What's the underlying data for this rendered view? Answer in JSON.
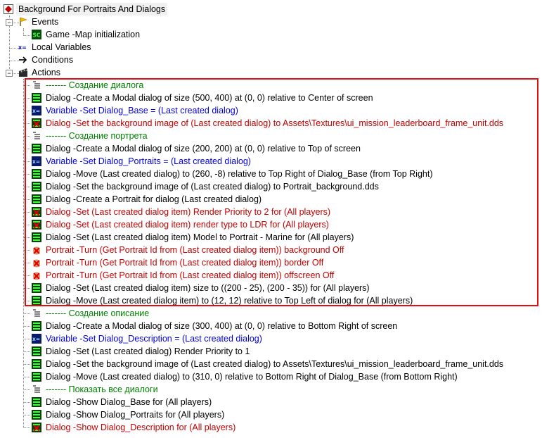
{
  "colors": {
    "black": "#000000",
    "blue": "#0000dd",
    "red": "#c00000",
    "green": "#008000",
    "selection_border": "#e01010"
  },
  "root": {
    "label": "Background For Portraits And Dialogs",
    "icon": "trigger-icon"
  },
  "events": {
    "label": "Events",
    "icon": "flag-icon"
  },
  "event_item": {
    "label": "Game -Map initialization",
    "icon": "event-sc-icon"
  },
  "local_variables": {
    "label": "Local Variables",
    "icon": "variables-icon"
  },
  "conditions": {
    "label": "Conditions",
    "icon": "arrow-icon"
  },
  "actions": {
    "label": "Actions",
    "icon": "clapper-icon"
  },
  "action_rows": [
    {
      "text": "------- Создание диалога",
      "color": "green",
      "icon": "comment-icon"
    },
    {
      "text": "Dialog -Create a Modal dialog of size (500, 400) at (0, 0) relative to Center of screen",
      "color": "black",
      "icon": "action-icon"
    },
    {
      "text": "Variable -Set Dialog_Base = (Last created dialog)",
      "color": "blue",
      "icon": "variable-set-icon"
    },
    {
      "text": "Dialog -Set the background image of (Last created dialog) to Assets\\Textures\\ui_mission_leaderboard_frame_unit.dds",
      "color": "red",
      "icon": "action-error-icon"
    },
    {
      "text": "------- Создание портрета",
      "color": "green",
      "icon": "comment-icon"
    },
    {
      "text": "Dialog -Create a Modal dialog of size (200, 200) at (0, 0) relative to Top of screen",
      "color": "black",
      "icon": "action-icon"
    },
    {
      "text": "Variable -Set Dialog_Portraits = (Last created dialog)",
      "color": "blue",
      "icon": "variable-set-icon"
    },
    {
      "text": "Dialog -Move (Last created dialog) to (260, -8) relative to Top Right of Dialog_Base (from Top Right)",
      "color": "black",
      "icon": "action-icon"
    },
    {
      "text": "Dialog -Set the background image of (Last created dialog) to Portrait_background.dds",
      "color": "black",
      "icon": "action-icon"
    },
    {
      "text": "Dialog -Create a Portrait for dialog (Last created dialog)",
      "color": "black",
      "icon": "action-icon"
    },
    {
      "text": "Dialog -Set (Last created dialog item) Render Priority to 2 for (All players)",
      "color": "red",
      "icon": "action-error-icon"
    },
    {
      "text": "Dialog -Set (Last created dialog item) render type to LDR for (All players)",
      "color": "red",
      "icon": "action-error-icon"
    },
    {
      "text": "Dialog -Set (Last created dialog item) Model  to Portrait - Marine for (All players)",
      "color": "black",
      "icon": "action-icon"
    },
    {
      "text": "Portrait -Turn (Get Portrait Id from (Last created dialog item)) background Off",
      "color": "red",
      "icon": "portrait-error-icon"
    },
    {
      "text": "Portrait -Turn (Get Portrait Id from (Last created dialog item)) border Off",
      "color": "red",
      "icon": "portrait-error-icon"
    },
    {
      "text": "Portrait -Turn (Get Portrait Id from (Last created dialog item)) offscreen Off",
      "color": "red",
      "icon": "portrait-error-icon"
    },
    {
      "text": "Dialog -Set (Last created dialog item) size to ((200 - 25), (200 - 35)) for (All players)",
      "color": "black",
      "icon": "action-icon"
    },
    {
      "text": "Dialog -Move (Last created dialog item) to (12, 12) relative to Top Left of dialog for (All players)",
      "color": "black",
      "icon": "action-icon"
    },
    {
      "text": "------- Создание описание",
      "color": "green",
      "icon": "comment-icon"
    },
    {
      "text": "Dialog -Create a Modal dialog of size (300, 400) at (0, 0) relative to Bottom Right of screen",
      "color": "black",
      "icon": "action-icon"
    },
    {
      "text": "Variable -Set Dialog_Description = (Last created dialog)",
      "color": "blue",
      "icon": "variable-set-icon"
    },
    {
      "text": "Dialog -Set (Last created dialog) Render Priority to 1",
      "color": "black",
      "icon": "action-icon"
    },
    {
      "text": "Dialog -Set the background image of (Last created dialog) to Assets\\Textures\\ui_mission_leaderboard_frame_unit.dds",
      "color": "black",
      "icon": "action-icon"
    },
    {
      "text": "Dialog -Move (Last created dialog) to (310, 0) relative to Bottom Right of Dialog_Base (from Bottom Right)",
      "color": "black",
      "icon": "action-icon"
    },
    {
      "text": "------- Показать все диалоги",
      "color": "green",
      "icon": "comment-icon"
    },
    {
      "text": "Dialog -Show Dialog_Base for (All players)",
      "color": "black",
      "icon": "action-icon"
    },
    {
      "text": "Dialog -Show Dialog_Portraits for (All players)",
      "color": "black",
      "icon": "action-icon"
    },
    {
      "text": "Dialog -Show Dialog_Description for (All players)",
      "color": "red",
      "icon": "action-error-icon"
    }
  ]
}
